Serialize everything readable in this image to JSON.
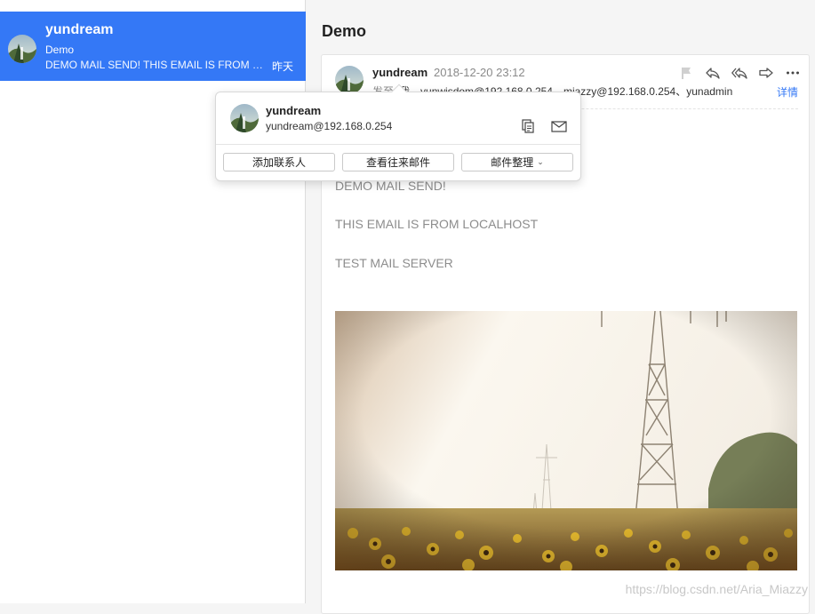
{
  "list": {
    "item": {
      "from": "yundream",
      "subject": "Demo",
      "preview": "DEMO MAIL SEND! THIS EMAIL IS FROM LOCALHOST",
      "time": "昨天"
    }
  },
  "message": {
    "title": "Demo",
    "sender": "yundream",
    "date": "2018-12-20 23:12",
    "recipients_label": "发至",
    "recipients": "我、yunwisdom@192.168.0.254、miazzy@192.168.0.254、yunadmin",
    "details_label": "详情",
    "body": [
      "DEMO MAIL SEND!",
      "THIS EMAIL IS FROM LOCALHOST",
      "TEST MAIL SERVER"
    ],
    "actions": [
      "flag-icon",
      "reply-icon",
      "reply-all-icon",
      "forward-icon",
      "more-icon"
    ]
  },
  "popover": {
    "name": "yundream",
    "address": "yundream@192.168.0.254",
    "buttons": {
      "add_contact": "添加联系人",
      "view_history": "查看往来邮件",
      "organize": "邮件整理"
    }
  },
  "watermark": "https://blog.csdn.net/Aria_Miazzy",
  "colors": {
    "accent": "#3478f6",
    "selected_bg": "#3478f6",
    "body_text": "#8d8d8d"
  }
}
